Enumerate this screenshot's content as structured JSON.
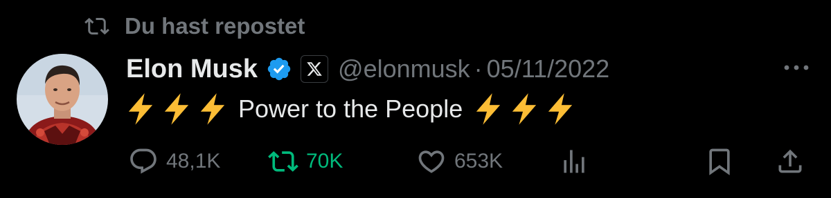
{
  "repost_header": {
    "label": "Du hast repostet",
    "icon": "repost-icon"
  },
  "author": {
    "display_name": "Elon Musk",
    "handle": "@elonmusk",
    "separator": "·",
    "date": "05/11/2022",
    "verified_icon": "verified-badge-icon",
    "affiliate_icon": "x-logo-icon",
    "avatar": "avatar"
  },
  "tweet": {
    "text": "Power to the People",
    "emoji": "high-voltage-emoji",
    "emoji_count_before": 3,
    "emoji_count_after": 3
  },
  "actions": {
    "replies": "48,1K",
    "reposts": "70K",
    "likes": "653K"
  },
  "colors": {
    "background": "#000000",
    "primary_text": "#e7e9ea",
    "secondary_text": "#71767b",
    "repost_active": "#00ba7c",
    "verified_blue": "#1d9bf0",
    "bolt_yellow": "#ffc83d"
  }
}
